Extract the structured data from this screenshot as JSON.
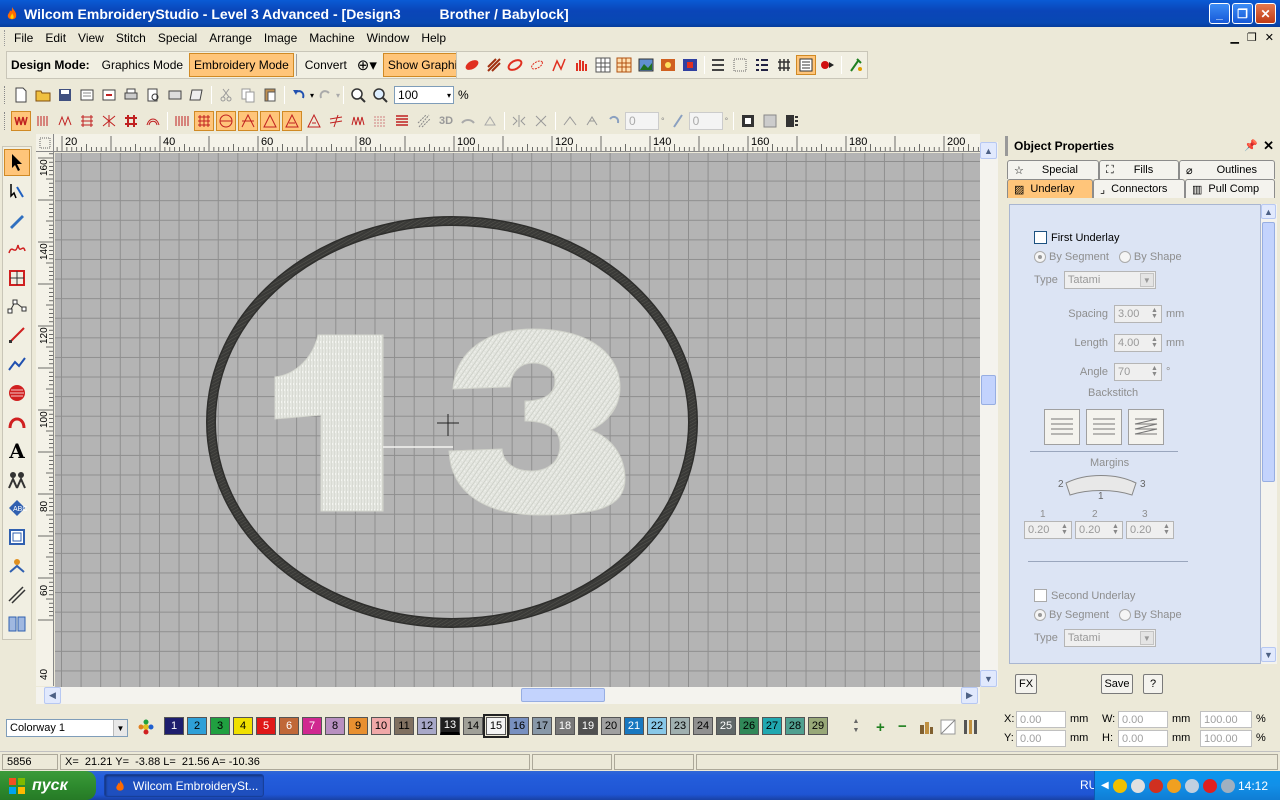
{
  "window": {
    "title": "Wilcom EmbroideryStudio - Level 3 Advanced - [Design3          Brother / Babylock]",
    "minimize": "_",
    "restore": "❐",
    "close": "✕"
  },
  "menu": [
    "File",
    "Edit",
    "View",
    "Stitch",
    "Special",
    "Arrange",
    "Image",
    "Machine",
    "Window",
    "Help"
  ],
  "design_mode": {
    "label": "Design Mode:",
    "graphics": "Graphics Mode",
    "embroidery": "Embroidery Mode",
    "convert": "Convert",
    "show_graphics": "Show Graphics"
  },
  "zoom": {
    "value": "100",
    "unit": "%"
  },
  "rulers": {
    "top": [
      "20",
      "40",
      "60",
      "80",
      "100",
      "120",
      "140",
      "160",
      "180",
      "200"
    ],
    "left": [
      "160",
      "140",
      "120",
      "100",
      "80",
      "60",
      "40"
    ]
  },
  "properties": {
    "title": "Object Properties",
    "tabs": [
      "Special",
      "Fills",
      "Outlines",
      "Underlay",
      "Connectors",
      "Pull Comp"
    ],
    "first_underlay": "First Underlay",
    "by_segment": "By Segment",
    "by_shape": "By Shape",
    "type_label": "Type",
    "type_value": "Tatami",
    "spacing_label": "Spacing",
    "spacing_value": "3.00",
    "length_label": "Length",
    "length_value": "4.00",
    "angle_label": "Angle",
    "angle_value": "70",
    "mm": "mm",
    "deg": "°",
    "backstitch": "Backstitch",
    "margins": "Margins",
    "margin_labels": [
      "1",
      "2",
      "3"
    ],
    "margin_values": [
      "0.20",
      "0.20",
      "0.20"
    ],
    "margin_diagram_labels": [
      "2",
      "1",
      "3"
    ],
    "second_underlay": "Second Underlay",
    "second_type_value": "Tatami",
    "fx": "FX",
    "save": "Save",
    "help": "?"
  },
  "colorway": "Colorway 1",
  "swatches": [
    {
      "n": "1",
      "c": "#1E1E6E",
      "t": "#FFFFFF"
    },
    {
      "n": "2",
      "c": "#2EA0D8",
      "t": "#000000"
    },
    {
      "n": "3",
      "c": "#20A040",
      "t": "#000000"
    },
    {
      "n": "4",
      "c": "#F0E000",
      "t": "#000000"
    },
    {
      "n": "5",
      "c": "#E01818",
      "t": "#FFFFFF"
    },
    {
      "n": "6",
      "c": "#C06838",
      "t": "#FFFFFF"
    },
    {
      "n": "7",
      "c": "#D02890",
      "t": "#FFFFFF"
    },
    {
      "n": "8",
      "c": "#B890C0",
      "t": "#000000"
    },
    {
      "n": "9",
      "c": "#E89030",
      "t": "#000000"
    },
    {
      "n": "10",
      "c": "#F0A8A8",
      "t": "#000000"
    },
    {
      "n": "11",
      "c": "#807060",
      "t": "#000000"
    },
    {
      "n": "12",
      "c": "#A8A8C8",
      "t": "#000000"
    },
    {
      "n": "13",
      "c": "#202020",
      "t": "#FFFFFF"
    },
    {
      "n": "14",
      "c": "#A0A098",
      "t": "#000000"
    },
    {
      "n": "15",
      "c": "#F4F4F4",
      "t": "#000000"
    },
    {
      "n": "16",
      "c": "#7890C0",
      "t": "#000000"
    },
    {
      "n": "17",
      "c": "#8898A8",
      "t": "#000000"
    },
    {
      "n": "18",
      "c": "#787878",
      "t": "#FFFFFF"
    },
    {
      "n": "19",
      "c": "#505050",
      "t": "#FFFFFF"
    },
    {
      "n": "20",
      "c": "#A0A0A0",
      "t": "#000000"
    },
    {
      "n": "21",
      "c": "#1878C0",
      "t": "#FFFFFF"
    },
    {
      "n": "22",
      "c": "#88C8E8",
      "t": "#000000"
    },
    {
      "n": "23",
      "c": "#A0B0B0",
      "t": "#000000"
    },
    {
      "n": "24",
      "c": "#909090",
      "t": "#000000"
    },
    {
      "n": "25",
      "c": "#606868",
      "t": "#FFFFFF"
    },
    {
      "n": "26",
      "c": "#308858",
      "t": "#000000"
    },
    {
      "n": "27",
      "c": "#20A8B0",
      "t": "#000000"
    },
    {
      "n": "28",
      "c": "#50A090",
      "t": "#000000"
    },
    {
      "n": "29",
      "c": "#98A878",
      "t": "#000000"
    }
  ],
  "coords": {
    "x_label": "X:",
    "y_label": "Y:",
    "w_label": "W:",
    "h_label": "H:",
    "x": "0.00",
    "y": "0.00",
    "w": "0.00",
    "h": "0.00",
    "wp": "100.00",
    "hp": "100.00",
    "mm": "mm",
    "pct": "%"
  },
  "status": {
    "stitches": "5856",
    "position": "X=  21.21 Y=  -3.88 L=  21.56 A= -10.36"
  },
  "taskbar": {
    "start": "пуск",
    "task": "Wilcom EmbroiderySt...",
    "lang": "RU",
    "time": "14:12"
  },
  "colors": {
    "accent": "#FFC57A",
    "outline_thread": "#3A3A38",
    "fill_thread": "#E2E4DE"
  }
}
